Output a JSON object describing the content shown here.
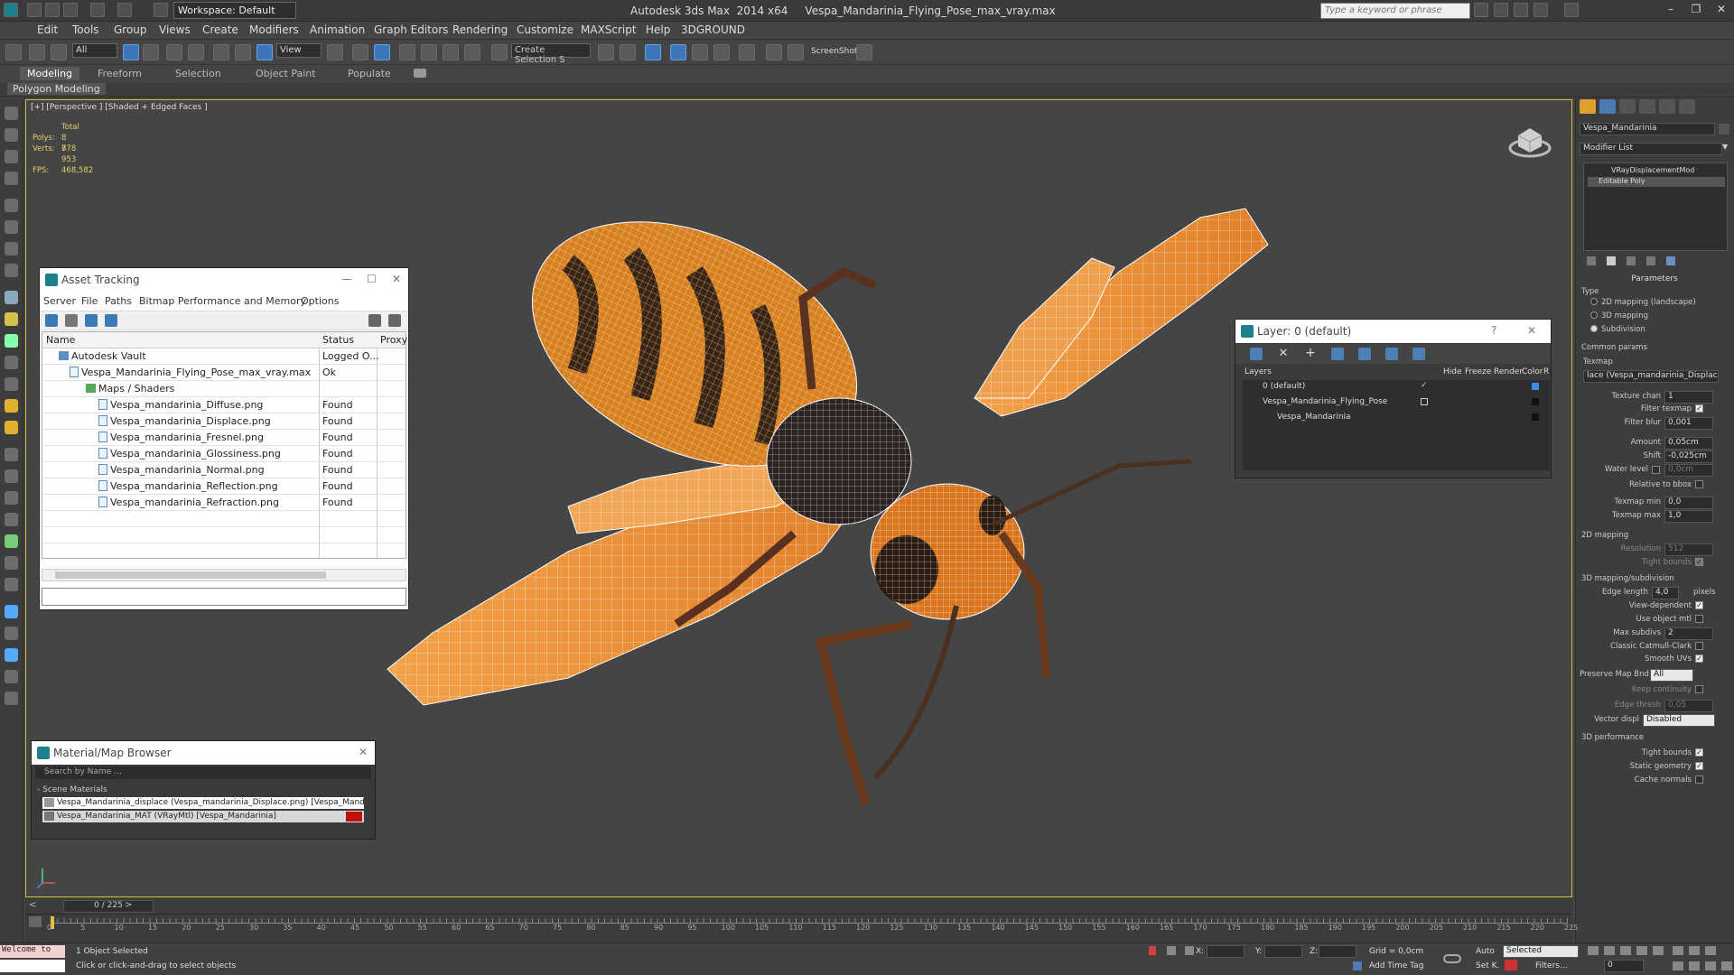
{
  "app": {
    "title": "Autodesk 3ds Max  2014 x64     Vespa_Mandarinia_Flying_Pose_max_vray.max",
    "workspace": "Workspace: Default",
    "search_placeholder": "Type a keyword or phrase"
  },
  "menu": [
    "Edit",
    "Tools",
    "Group",
    "Views",
    "Create",
    "Modifiers",
    "Animation",
    "Graph Editors",
    "Rendering",
    "Customize",
    "MAXScript",
    "Help",
    "3DGROUND"
  ],
  "toolbar": {
    "selection_filter": "All",
    "ref_coord": "View",
    "named_selection": "Create Selection S",
    "screenshot_label": "ScreenShot"
  },
  "ribbon": {
    "tabs": [
      "Modeling",
      "Freeform",
      "Selection",
      "Object Paint",
      "Populate"
    ],
    "sub": "Polygon Modeling"
  },
  "viewport": {
    "label": "[+] [Perspective ] [Shaded + Edged Faces ]",
    "stats_header": "Total",
    "polys_label": "Polys:",
    "polys": "8 778",
    "verts_label": "Verts:",
    "verts": "8 953",
    "fps_label": "FPS:",
    "fps": "468,582"
  },
  "asset_tracking": {
    "title": "Asset Tracking",
    "menu": [
      "Server",
      "File",
      "Paths",
      "Bitmap Performance and Memory",
      "Options"
    ],
    "headers": {
      "name": "Name",
      "status": "Status",
      "proxy": "Proxy"
    },
    "rows": [
      {
        "name": "Autodesk Vault",
        "status": "Logged O..."
      },
      {
        "name": "Vespa_Mandarinia_Flying_Pose_max_vray.max",
        "status": "Ok"
      },
      {
        "name": "Maps / Shaders",
        "status": ""
      },
      {
        "name": "Vespa_mandarinia_Diffuse.png",
        "status": "Found"
      },
      {
        "name": "Vespa_mandarinia_Displace.png",
        "status": "Found"
      },
      {
        "name": "Vespa_mandarinia_Fresnel.png",
        "status": "Found"
      },
      {
        "name": "Vespa_mandarinia_Glossiness.png",
        "status": "Found"
      },
      {
        "name": "Vespa_mandarinia_Normal.png",
        "status": "Found"
      },
      {
        "name": "Vespa_mandarinia_Reflection.png",
        "status": "Found"
      },
      {
        "name": "Vespa_mandarinia_Refraction.png",
        "status": "Found"
      }
    ]
  },
  "material_browser": {
    "title": "Material/Map Browser",
    "search_placeholder": "Search by Name ...",
    "section": "- Scene Materials",
    "items": [
      "Vespa_Mandarinia_displace (Vespa_mandarinia_Displace.png) [Vespa_Mandarinia]",
      "Vespa_Mandarinia_MAT (VRayMtl) [Vespa_Mandarinia]"
    ]
  },
  "layer_dialog": {
    "title": "Layer: 0 (default)",
    "headers": {
      "layers": "Layers",
      "hide": "Hide",
      "freeze": "Freeze",
      "render": "Render",
      "color": "Color",
      "r": "R"
    },
    "rows": [
      "0 (default)",
      "Vespa_Mandarinia_Flying_Pose",
      "Vespa_Mandarinia"
    ]
  },
  "command_panel": {
    "object_name": "Vespa_Mandarinia",
    "modifier_list": "Modifier List",
    "stack": [
      "VRayDisplacementMod",
      "Editable Poly"
    ],
    "parameters": "Parameters",
    "type_label": "Type",
    "types": [
      "2D mapping (landscape)",
      "3D mapping",
      "Subdivision"
    ],
    "common_params": "Common params",
    "texmap_label": "Texmap",
    "texmap_value": "lace (Vespa_mandarinia_Displace.png)",
    "texture_chan_label": "Texture chan",
    "texture_chan": "1",
    "filter_texmap": "Filter texmap",
    "filter_blur_label": "Filter blur",
    "filter_blur": "0,001",
    "amount_label": "Amount",
    "amount": "0,05cm",
    "shift_label": "Shift",
    "shift": "-0,025cm",
    "water_level_label": "Water level",
    "water_level": "0,0cm",
    "relative_bbox": "Relative to bbox",
    "texmap_min_label": "Texmap min",
    "texmap_min": "0,0",
    "texmap_max_label": "Texmap max",
    "texmap_max": "1,0",
    "mapping_2d": "2D mapping",
    "resolution_label": "Resolution",
    "resolution": "512",
    "tight_bounds": "Tight bounds",
    "mapping_3d": "3D mapping/subdivision",
    "edge_length_label": "Edge length",
    "edge_length": "4,0",
    "pixels": "pixels",
    "view_dependent": "View-dependent",
    "use_object_mtl": "Use object mtl",
    "max_subdivs_label": "Max subdivs",
    "max_subdivs": "2",
    "classic_catmull": "Classic Catmull-Clark",
    "smooth_uvs": "Smooth UVs",
    "preserve_map_bnd_label": "Preserve Map Bnd",
    "preserve_map_bnd": "All",
    "keep_continuity": "Keep continuity",
    "edge_thresh_label": "Edge thresh",
    "edge_thresh": "0,05",
    "vector_displ_label": "Vector displ",
    "vector_displ": "Disabled",
    "perf_3d": "3D performance",
    "tight_bounds2": "Tight bounds",
    "static_geometry": "Static geometry",
    "cache_normals": "Cache normals"
  },
  "timeline": {
    "slider": "0 / 225",
    "ticks": [
      "0",
      "5",
      "10",
      "15",
      "20",
      "25",
      "30",
      "35",
      "40",
      "45",
      "50",
      "55",
      "60",
      "65",
      "70",
      "75",
      "80",
      "85",
      "90",
      "95",
      "100",
      "105",
      "110",
      "115",
      "120",
      "125",
      "130",
      "135",
      "140",
      "145",
      "150",
      "155",
      "160",
      "165",
      "170",
      "175",
      "180",
      "185",
      "190",
      "195",
      "200",
      "205",
      "210",
      "215",
      "220",
      "225"
    ]
  },
  "status": {
    "maxscript": "Welcome to",
    "selected_count": "1 Object Selected",
    "prompt": "Click or click-and-drag to select objects",
    "x_label": "X:",
    "y_label": "Y:",
    "z_label": "Z:",
    "grid": "Grid = 0,0cm",
    "add_time_tag": "Add Time Tag",
    "auto": "Auto",
    "selected_dropdown": "Selected",
    "set_k": "Set K.",
    "filters": "Filters...",
    "frame": "0"
  },
  "colors": {
    "viewport_bg": "#454545",
    "active_viewport_border": "#d4b84a",
    "wing_orange": "#e8913a",
    "stats_yellow": "#e0d070"
  }
}
